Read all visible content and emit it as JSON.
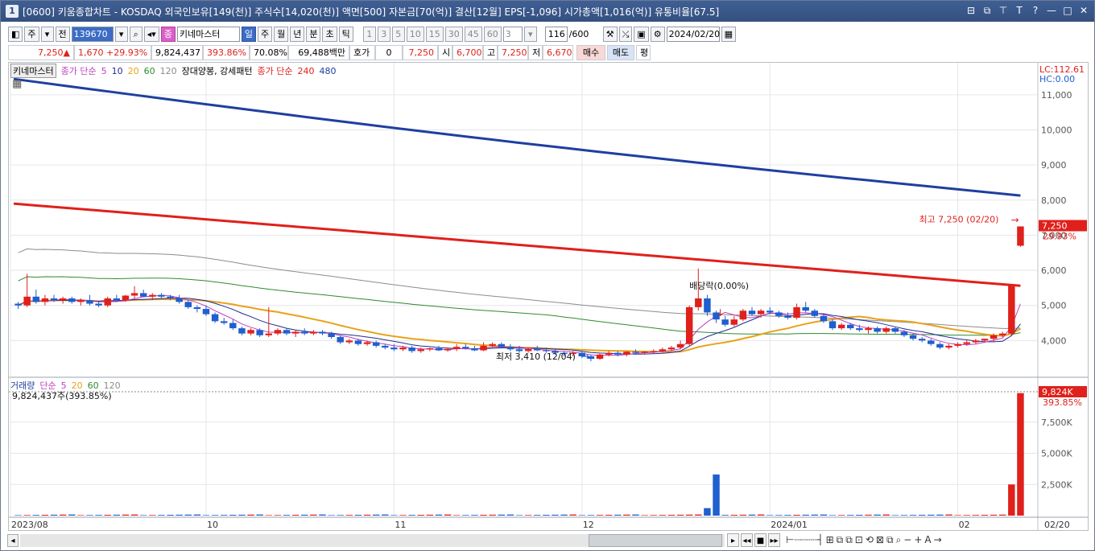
{
  "window": {
    "app_icon": "1",
    "title": "[0600] 키움종합차트 - KOSDAQ 외국인보유[149(천)] 주식수[14,020(천)] 액면[500] 자본금[70(억)] 결산[12월] EPS[-1,096] 시가총액[1,016(억)] 유통비율[67.5]",
    "buttons": [
      "⊟",
      "⧉",
      "⊤",
      "T",
      "?",
      "—",
      "□",
      "✕"
    ]
  },
  "toolbar": {
    "type_select": "주",
    "prev_label": "전",
    "code": "139670",
    "search_icon": "search-icon",
    "stock_name": "키네마스터",
    "periods": [
      "일",
      "주",
      "월",
      "년",
      "분",
      "초",
      "틱"
    ],
    "period_selected": "일",
    "minutes": [
      "1",
      "3",
      "5",
      "10",
      "15",
      "30",
      "45",
      "60"
    ],
    "minute_select": "3",
    "count": "116",
    "count_max": "/600",
    "date": "2024/02/20"
  },
  "quote": {
    "price": "7,250",
    "arrow": "▲",
    "change": "1,670",
    "pct": "+29.93%",
    "volume": "9,824,437",
    "vol_ratio": "393.86%",
    "rate": "70.08%",
    "amount": "69,488백만",
    "hoga_label": "호가",
    "hoga_value": "0",
    "hoga_price": "7,250",
    "open_label": "시",
    "open": "6,700",
    "high_label": "고",
    "high": "7,250",
    "low_label": "저",
    "low": "6,670",
    "buy": "매수",
    "sell": "매도",
    "eval": "평"
  },
  "price_legend": {
    "name": "키네마스터",
    "ma_label": "종가 단순",
    "ma_periods": [
      "5",
      "10",
      "20",
      "60",
      "120"
    ],
    "pattern": "장대양봉, 강세패턴",
    "ma2_label": "종가 단순",
    "ma2_periods": [
      "240",
      "480"
    ]
  },
  "vol_legend": {
    "title": "거래량",
    "ma_label": "단순",
    "ma_periods": [
      "5",
      "20",
      "60",
      "120"
    ],
    "current": "9,824,437주(393.85%)"
  },
  "colors": {
    "ma5": "#c03fbf",
    "ma10": "#1f2d8f",
    "ma20": "#e8a21a",
    "ma60": "#2e8b2e",
    "ma120": "#8c8c8c",
    "ma240": "#e0201b",
    "ma480": "#1f3f9f",
    "up": "#e0201b",
    "down": "#1f5fcf"
  },
  "annotations": {
    "lc": "LC:112.61",
    "hc": "HC:0.00",
    "high_note": "최고 7,250 (02/20)",
    "low_note": "최저 3,410 (12/04)",
    "div_note": "배당락(0.00%)",
    "last_price": "7,250",
    "last_pct": "29.93%",
    "last_vol": "9,824K",
    "last_vol_pct": "393.85%"
  },
  "chart_data": [
    {
      "type": "candlestick",
      "title": "키네마스터",
      "x_ticks": [
        "2023/08",
        "10",
        "11",
        "12",
        "2024/01",
        "02",
        "02/20"
      ],
      "y_ticks": [
        4000,
        5000,
        6000,
        7000,
        8000,
        9000,
        10000,
        11000
      ],
      "ylim": [
        3000,
        11500
      ],
      "series": [
        {
          "name": "종가 단순 240",
          "approx_start": 7900,
          "approx_end": 5560
        },
        {
          "name": "종가 단순 480",
          "approx_start": 11450,
          "approx_end": 8130
        }
      ],
      "ohlc": [
        [
          5050,
          5100,
          4900,
          5000
        ],
        [
          5000,
          5900,
          4950,
          5250
        ],
        [
          5250,
          5450,
          5050,
          5100
        ],
        [
          5100,
          5300,
          5000,
          5200
        ],
        [
          5200,
          5300,
          5100,
          5150
        ],
        [
          5150,
          5250,
          5050,
          5200
        ],
        [
          5200,
          5250,
          5050,
          5100
        ],
        [
          5100,
          5200,
          5000,
          5150
        ],
        [
          5150,
          5300,
          5000,
          5050
        ],
        [
          5050,
          5100,
          4950,
          5000
        ],
        [
          5000,
          5250,
          4950,
          5200
        ],
        [
          5200,
          5300,
          5100,
          5150
        ],
        [
          5150,
          5300,
          5100,
          5280
        ],
        [
          5280,
          5550,
          5200,
          5350
        ],
        [
          5350,
          5450,
          5250,
          5250
        ],
        [
          5250,
          5350,
          5150,
          5300
        ],
        [
          5300,
          5350,
          5200,
          5250
        ],
        [
          5250,
          5300,
          5150,
          5200
        ],
        [
          5200,
          5300,
          5050,
          5100
        ],
        [
          5100,
          5150,
          4900,
          4950
        ],
        [
          4950,
          5000,
          4800,
          4900
        ],
        [
          4900,
          5000,
          4700,
          4750
        ],
        [
          4750,
          4800,
          4500,
          4550
        ],
        [
          4550,
          4650,
          4450,
          4500
        ],
        [
          4500,
          4600,
          4300,
          4350
        ],
        [
          4350,
          4400,
          4150,
          4200
        ],
        [
          4200,
          4350,
          4150,
          4300
        ],
        [
          4300,
          4350,
          4100,
          4150
        ],
        [
          4150,
          4950,
          4100,
          4200
        ],
        [
          4200,
          4350,
          4150,
          4300
        ],
        [
          4300,
          4350,
          4150,
          4200
        ],
        [
          4200,
          4300,
          4100,
          4250
        ],
        [
          4250,
          4350,
          4150,
          4200
        ],
        [
          4200,
          4300,
          4150,
          4250
        ],
        [
          4250,
          4300,
          4150,
          4200
        ],
        [
          4200,
          4250,
          4050,
          4100
        ],
        [
          4100,
          4150,
          3900,
          3950
        ],
        [
          3950,
          4050,
          3900,
          4000
        ],
        [
          4000,
          4050,
          3850,
          3900
        ],
        [
          3900,
          4000,
          3850,
          3950
        ],
        [
          3950,
          4000,
          3800,
          3850
        ],
        [
          3850,
          3900,
          3750,
          3800
        ],
        [
          3800,
          3900,
          3700,
          3750
        ],
        [
          3750,
          3850,
          3700,
          3800
        ],
        [
          3800,
          3850,
          3650,
          3700
        ],
        [
          3700,
          3800,
          3650,
          3750
        ],
        [
          3750,
          3800,
          3700,
          3780
        ],
        [
          3780,
          3850,
          3700,
          3720
        ],
        [
          3720,
          3800,
          3680,
          3760
        ],
        [
          3760,
          3900,
          3700,
          3820
        ],
        [
          3820,
          3900,
          3750,
          3780
        ],
        [
          3780,
          3850,
          3700,
          3720
        ],
        [
          3720,
          3950,
          3700,
          3850
        ],
        [
          3850,
          3950,
          3800,
          3900
        ],
        [
          3900,
          3950,
          3800,
          3820
        ],
        [
          3820,
          3900,
          3700,
          3750
        ],
        [
          3750,
          3850,
          3650,
          3700
        ],
        [
          3700,
          3800,
          3650,
          3760
        ],
        [
          3760,
          3850,
          3700,
          3720
        ],
        [
          3720,
          3800,
          3650,
          3700
        ],
        [
          3700,
          3750,
          3600,
          3650
        ],
        [
          3650,
          3700,
          3550,
          3620
        ],
        [
          3620,
          3700,
          3550,
          3650
        ],
        [
          3650,
          3700,
          3500,
          3550
        ],
        [
          3550,
          3600,
          3410,
          3480
        ],
        [
          3480,
          3650,
          3450,
          3600
        ],
        [
          3600,
          3700,
          3550,
          3650
        ],
        [
          3650,
          3700,
          3550,
          3600
        ],
        [
          3600,
          3700,
          3550,
          3680
        ],
        [
          3680,
          3750,
          3600,
          3650
        ],
        [
          3650,
          3700,
          3600,
          3680
        ],
        [
          3680,
          3750,
          3620,
          3700
        ],
        [
          3700,
          3800,
          3650,
          3750
        ],
        [
          3750,
          3850,
          3700,
          3800
        ],
        [
          3800,
          4000,
          3750,
          3900
        ],
        [
          3900,
          5000,
          3850,
          4950
        ],
        [
          4950,
          6050,
          4850,
          5200
        ],
        [
          5200,
          5300,
          4700,
          4800
        ],
        [
          4800,
          4850,
          4500,
          4600
        ],
        [
          4600,
          4700,
          4400,
          4450
        ],
        [
          4450,
          4700,
          4400,
          4600
        ],
        [
          4600,
          4900,
          4550,
          4850
        ],
        [
          4850,
          4950,
          4700,
          4750
        ],
        [
          4750,
          4900,
          4650,
          4850
        ],
        [
          4850,
          4950,
          4750,
          4800
        ],
        [
          4800,
          4850,
          4650,
          4700
        ],
        [
          4700,
          4800,
          4600,
          4650
        ],
        [
          4650,
          5050,
          4600,
          4950
        ],
        [
          4950,
          5100,
          4800,
          4850
        ],
        [
          4850,
          4900,
          4650,
          4700
        ],
        [
          4700,
          4750,
          4500,
          4550
        ],
        [
          4550,
          4600,
          4300,
          4350
        ],
        [
          4350,
          4500,
          4300,
          4450
        ],
        [
          4450,
          4500,
          4300,
          4350
        ],
        [
          4350,
          4450,
          4250,
          4300
        ],
        [
          4300,
          4400,
          4200,
          4350
        ],
        [
          4350,
          4400,
          4200,
          4250
        ],
        [
          4250,
          4400,
          4200,
          4350
        ],
        [
          4350,
          4400,
          4200,
          4250
        ],
        [
          4250,
          4300,
          4100,
          4150
        ],
        [
          4150,
          4200,
          4000,
          4050
        ],
        [
          4050,
          4100,
          3950,
          4000
        ],
        [
          4000,
          4050,
          3850,
          3900
        ],
        [
          3900,
          3950,
          3750,
          3800
        ],
        [
          3800,
          3900,
          3750,
          3850
        ],
        [
          3850,
          3950,
          3800,
          3900
        ],
        [
          3900,
          4000,
          3850,
          3950
        ],
        [
          3950,
          4050,
          3900,
          4000
        ],
        [
          4000,
          4050,
          3950,
          4050
        ],
        [
          4050,
          4200,
          3950,
          4150
        ],
        [
          4150,
          4250,
          4100,
          4200
        ],
        [
          4200,
          5600,
          4150,
          5580
        ],
        [
          6700,
          7250,
          6670,
          7250
        ]
      ],
      "low_marker": 3410,
      "high_marker": 7250
    },
    {
      "type": "bar",
      "title": "거래량",
      "y_ticks_labels": [
        "2,500K",
        "5,000K",
        "7,500K"
      ],
      "ylim": [
        0,
        10000
      ],
      "last_value_k": 9824,
      "notable_bars_k": {
        "late_dec_1": 600,
        "late_dec_2": 3300,
        "feb_prev": 2500,
        "feb_last": 9824
      }
    }
  ]
}
